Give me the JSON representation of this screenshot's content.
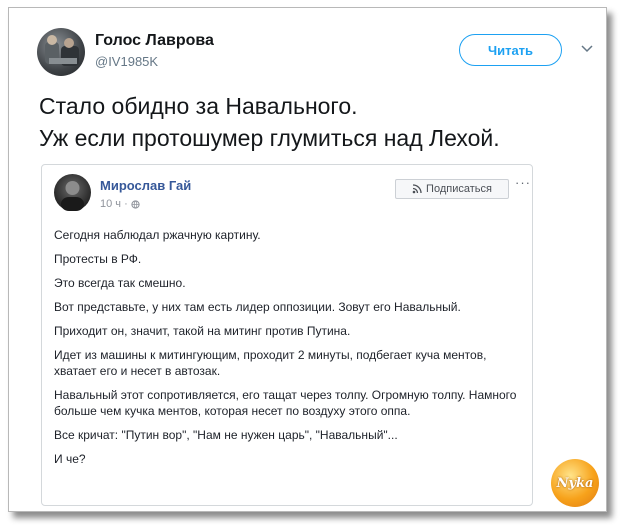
{
  "tweet": {
    "author_name": "Голос Лаврова",
    "author_handle": "@IV1985K",
    "follow_label": "Читать",
    "text_line1": "Стало обидно за Навального.",
    "text_line2": "Уж если протошумер глумиться над Лехой."
  },
  "facebook_post": {
    "author_name": "Мирослав Гай",
    "time": "10 ч ·",
    "subscribe_label": "Подписаться",
    "more_label": "···",
    "paragraphs": [
      "Сегодня наблюдал ржачную картину.",
      "Протесты в РФ.",
      "Это всегда так смешно.",
      "Вот представьте, у них там есть лидер оппозиции. Зовут его Навальный.",
      "Приходит он, значит, такой на митинг против Путина.",
      "Идет из машины к митингующим, проходит 2 минуты, подбегает куча ментов, хватает его и несет в автозак.",
      "Навальный этот сопротивляется, его тащат через толпу. Огромную толпу. Намного больше чем кучка ментов, которая несет по воздуху этого оппа.",
      "Все кричат: \"Путин вор\", \"Нам не нужен царь\", \"Навальный\"...",
      "И че?"
    ]
  },
  "watermark_text": "Nyka",
  "colors": {
    "twitter_blue": "#1da1f2",
    "facebook_link": "#365899",
    "text": "#14171a",
    "muted": "#657786"
  }
}
